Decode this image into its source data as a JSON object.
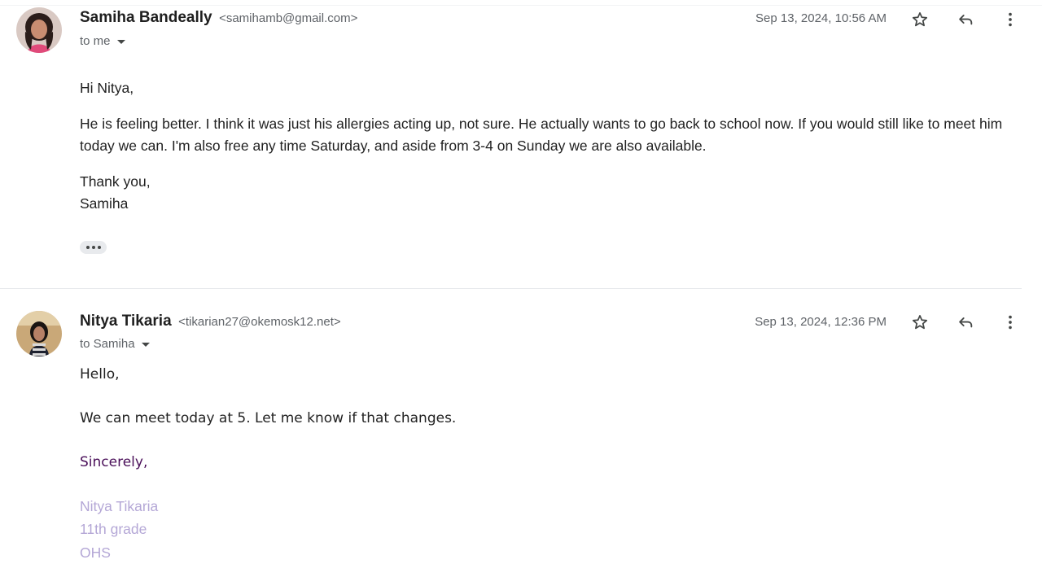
{
  "messages": [
    {
      "sender_name": "Samiha Bandeally",
      "sender_email": "<samihamb@gmail.com>",
      "recipient": "to me",
      "timestamp": "Sep 13, 2024, 10:56 AM",
      "greeting": "Hi Nitya,",
      "body": "He is feeling better. I think it was just his allergies acting up, not sure. He actually wants to go back to school now. If you would still like to meet him today we can. I'm also free any time Saturday, and aside from 3-4 on Sunday we are also available.",
      "closing": "Thank you,",
      "signature": "Samiha"
    },
    {
      "sender_name": "Nitya Tikaria",
      "sender_email": "<tikarian27@okemosk12.net>",
      "recipient": "to Samiha",
      "timestamp": "Sep 13, 2024, 12:36 PM",
      "greeting": "Hello,",
      "body": "We can meet today at 5. Let me know if that changes.",
      "closing": "Sincerely,",
      "signature_lines": [
        "Nitya Tikaria",
        "11th grade",
        "OHS"
      ]
    }
  ],
  "icons": {
    "star": "star-icon",
    "reply": "reply-icon",
    "more": "more-vert-icon",
    "ellipsis": "show-trimmed-content-icon"
  },
  "colors": {
    "closing_purple": "#4a0f59",
    "signature_lavender": "#b4a7d6",
    "meta_gray": "#5f6368"
  }
}
